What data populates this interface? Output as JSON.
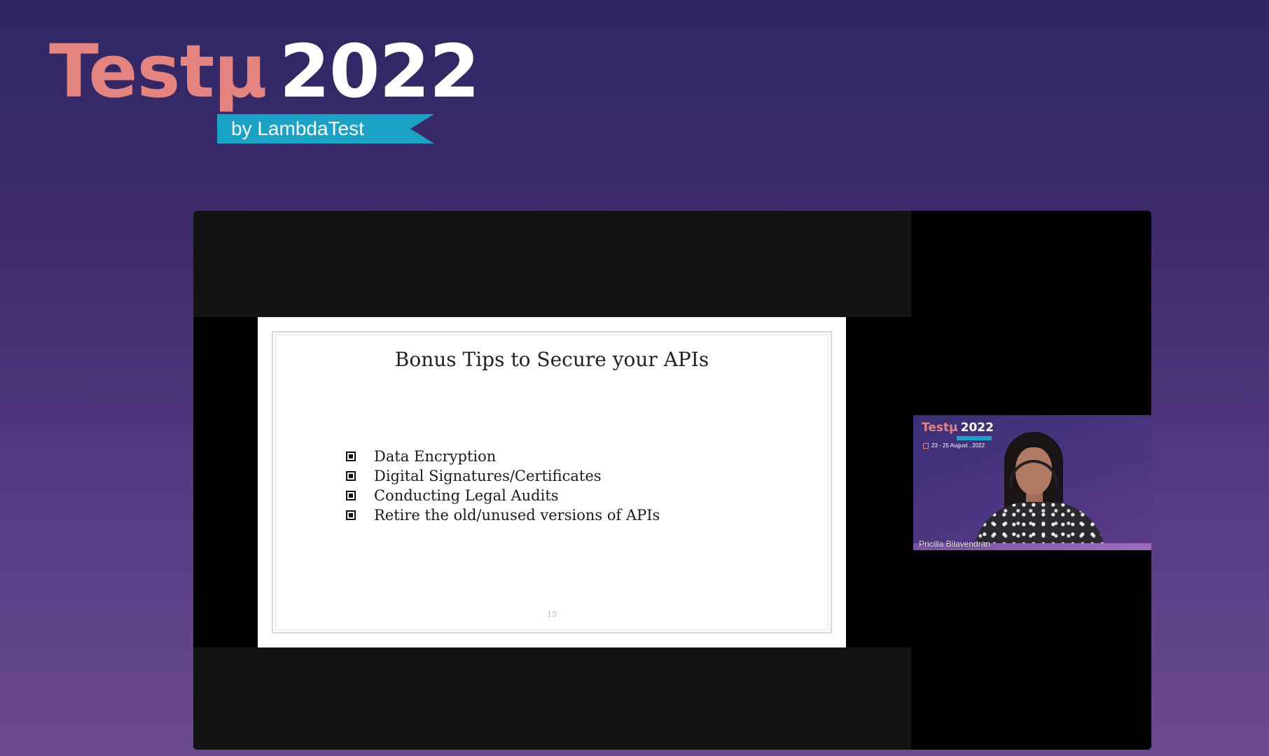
{
  "event": {
    "brand_word": "Testμ",
    "year": "2022",
    "ribbon": "by LambdaTest"
  },
  "slide": {
    "title": "Bonus Tips to Secure your APIs",
    "bullets": [
      "Data Encryption",
      "Digital Signatures/Certificates",
      "Conducting Legal Audits",
      "Retire the old/unused versions of APIs"
    ],
    "page_number": "15"
  },
  "speaker": {
    "name": "Pricilla Bilavendran",
    "overlay_brand_word": "Testμ",
    "overlay_year": "2022",
    "overlay_date": "23 - 25 August , 2022"
  },
  "colors": {
    "brand_coral": "#e5847f",
    "ribbon_cyan": "#1aa2c7",
    "background_top": "#2f2765",
    "background_bottom": "#6a4a8f"
  },
  "icons": {
    "bullet": "square-bullet-icon",
    "calendar": "calendar-icon"
  }
}
